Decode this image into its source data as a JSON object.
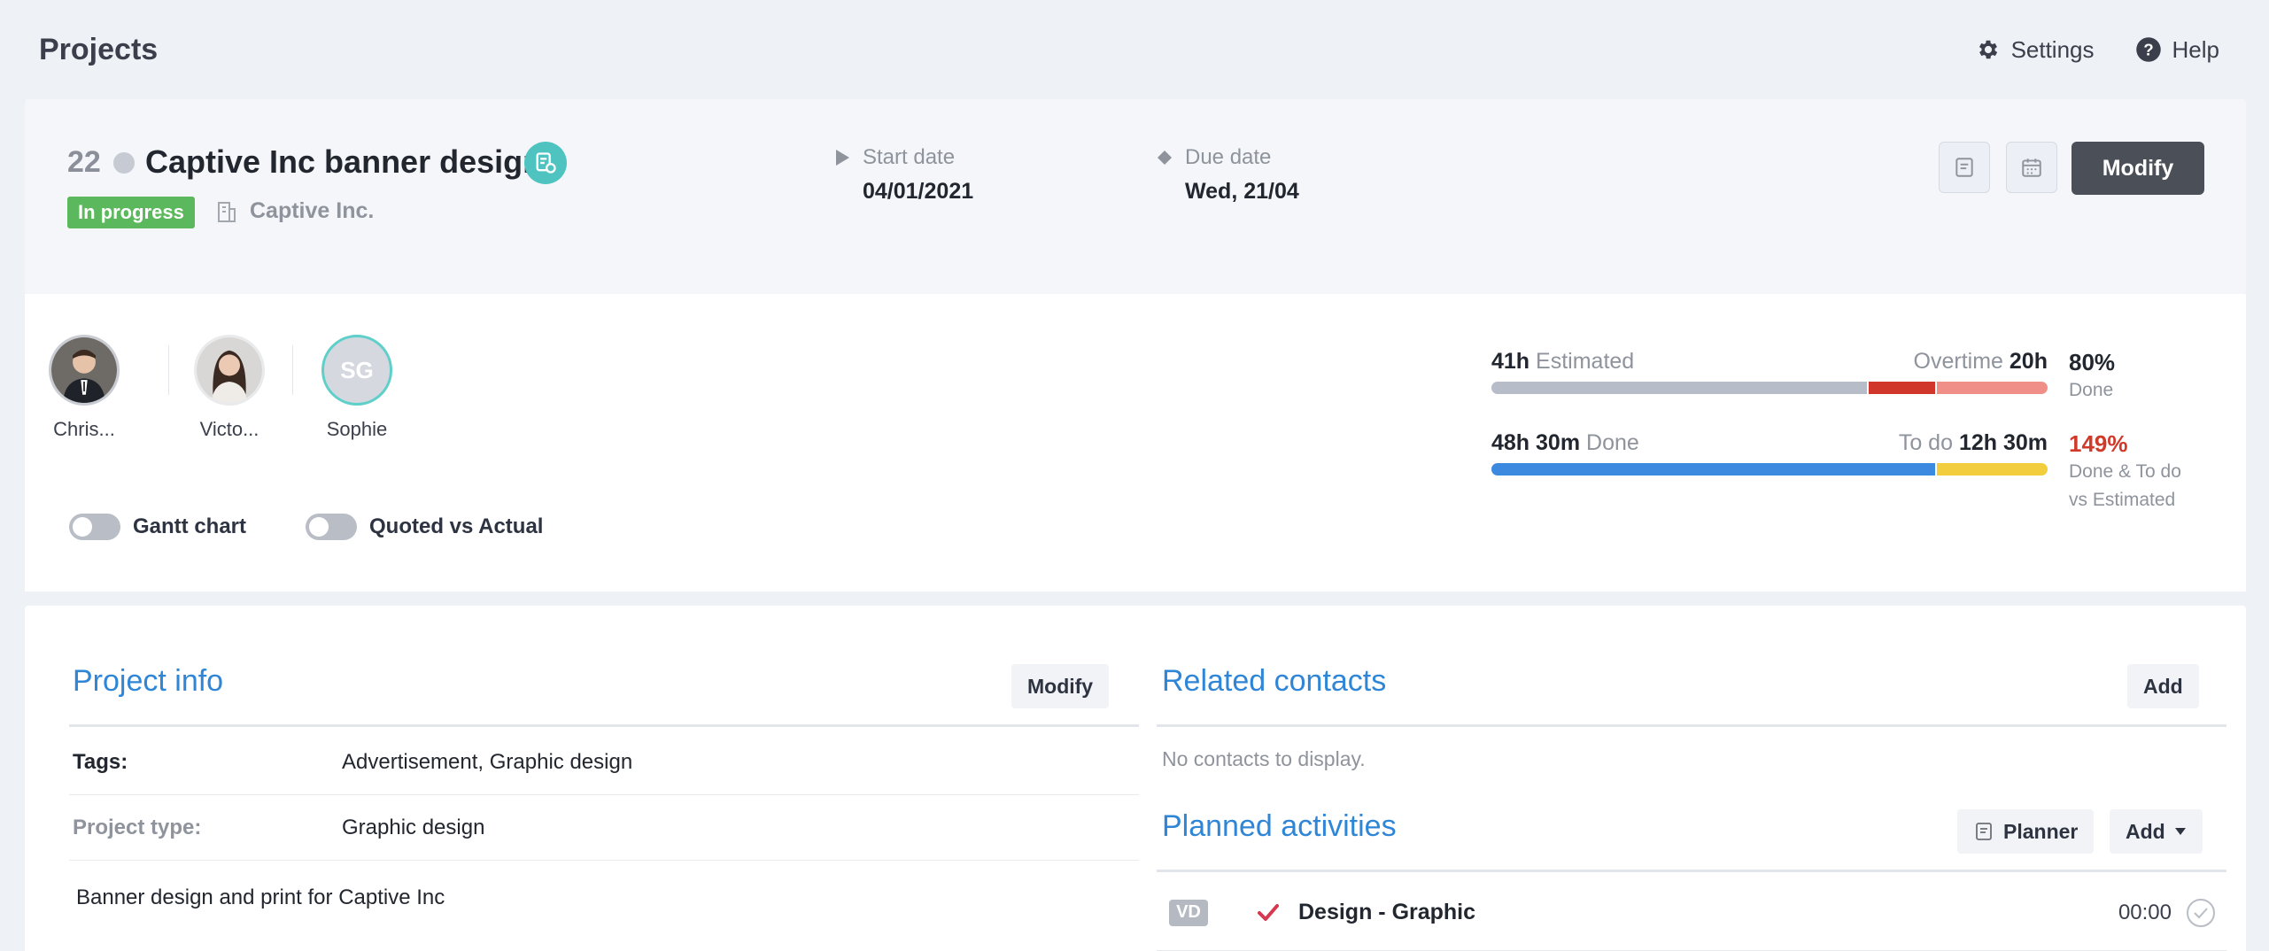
{
  "header": {
    "title": "Projects",
    "settings_label": "Settings",
    "help_label": "Help"
  },
  "project": {
    "number": "22",
    "name": "Captive Inc banner design",
    "status": "In progress",
    "company": "Captive Inc.",
    "start_label": "Start date",
    "start_value": "04/01/2021",
    "due_label": "Due date",
    "due_value": "Wed, 21/04",
    "modify_label": "Modify"
  },
  "members": [
    {
      "name": "Chris..."
    },
    {
      "name": "Victo..."
    },
    {
      "name": "Sophie",
      "initials": "SG"
    }
  ],
  "toggles": {
    "gantt_label": "Gantt chart",
    "gantt_on": false,
    "quoted_label": "Quoted vs Actual",
    "quoted_on": false
  },
  "metrics": {
    "estimated_value": "41h",
    "estimated_label": "Estimated",
    "overtime_label": "Overtime",
    "overtime_value": "20h",
    "done_pct": "80%",
    "done_pct_label": "Done",
    "done_value": "48h 30m",
    "done_label": "Done",
    "todo_label": "To do",
    "todo_value": "12h 30m",
    "ratio_pct": "149%",
    "ratio_label_1": "Done & To do",
    "ratio_label_2": "vs Estimated",
    "colors": {
      "estimated": "#b6bcc8",
      "overtime_done": "#d0362a",
      "overtime_remaining": "#ef8f88",
      "done": "#3b8ae0",
      "todo": "#f2cd3d"
    }
  },
  "project_info": {
    "title": "Project info",
    "modify_label": "Modify",
    "tags_key": "Tags:",
    "tags_value": "Advertisement, Graphic design",
    "type_key": "Project type:",
    "type_value": "Graphic design",
    "description": "Banner design and print for Captive Inc"
  },
  "related_contacts": {
    "title": "Related contacts",
    "add_label": "Add",
    "empty_text": "No contacts to display."
  },
  "planned_activities": {
    "title": "Planned activities",
    "planner_label": "Planner",
    "add_label": "Add",
    "items": [
      {
        "initials": "VD",
        "title": "Design - Graphic",
        "time": "00:00"
      }
    ]
  }
}
